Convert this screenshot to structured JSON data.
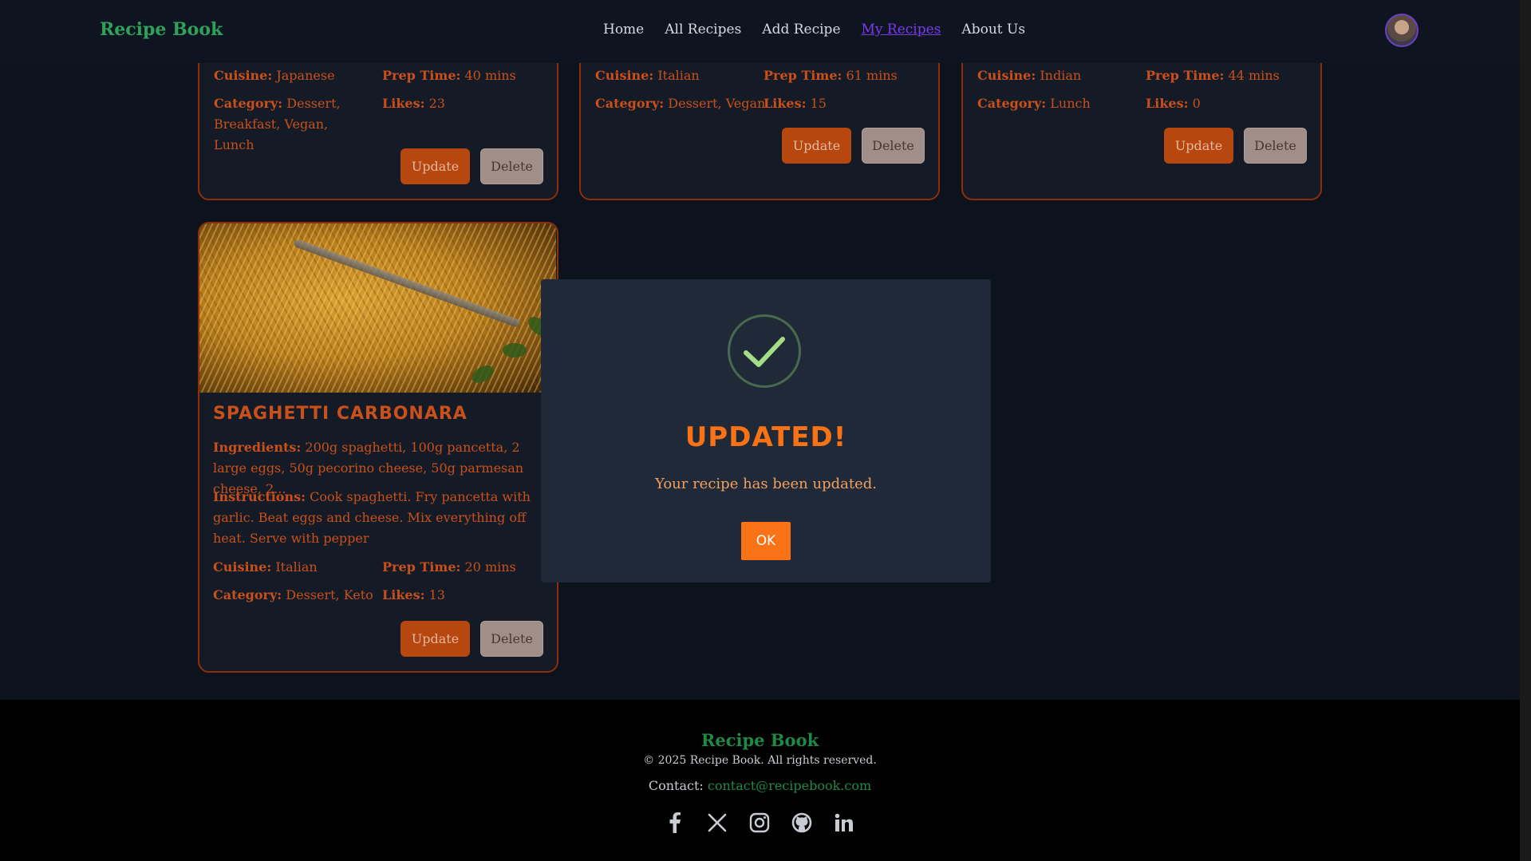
{
  "nav": {
    "brand": "Recipe Book",
    "links": [
      "Home",
      "All Recipes",
      "Add Recipe",
      "My Recipes",
      "About Us"
    ],
    "active": "My Recipes"
  },
  "cards_top": [
    {
      "cuisine_label": "Cuisine:",
      "cuisine": "Japanese",
      "prep_label": "Prep Time:",
      "prep": "40 mins",
      "category_label": "Category:",
      "category": "Dessert, Breakfast, Vegan, Lunch",
      "likes_label": "Likes:",
      "likes": "23",
      "update": "Update",
      "delete": "Delete"
    },
    {
      "cuisine_label": "Cuisine:",
      "cuisine": "Italian",
      "prep_label": "Prep Time:",
      "prep": "61 mins",
      "category_label": "Category:",
      "category": "Dessert, Vegan",
      "likes_label": "Likes:",
      "likes": "15",
      "update": "Update",
      "delete": "Delete"
    },
    {
      "cuisine_label": "Cuisine:",
      "cuisine": "Indian",
      "prep_label": "Prep Time:",
      "prep": "44 mins",
      "category_label": "Category:",
      "category": "Lunch",
      "likes_label": "Likes:",
      "likes": "0",
      "update": "Update",
      "delete": "Delete"
    }
  ],
  "card_main": {
    "title": "SPAGHETTI CARBONARA",
    "ingredients_label": "Ingredients:",
    "ingredients": "200g spaghetti, 100g pancetta, 2 large eggs, 50g pecorino cheese, 50g parmesan cheese, 2...",
    "instructions_label": "Instructions:",
    "instructions": "Cook spaghetti. Fry pancetta with garlic. Beat eggs and cheese. Mix everything off heat. Serve with pepper",
    "cuisine_label": "Cuisine:",
    "cuisine": "Italian",
    "prep_label": "Prep Time:",
    "prep": "20 mins",
    "category_label": "Category:",
    "category": "Dessert, Keto",
    "likes_label": "Likes:",
    "likes": "13",
    "update": "Update",
    "delete": "Delete"
  },
  "modal": {
    "title": "UPDATED!",
    "text": "Your recipe has been updated.",
    "ok": "OK"
  },
  "footer": {
    "brand": "Recipe Book",
    "copyright": "© 2025 Recipe Book. All rights reserved.",
    "contact_label": "Contact:",
    "contact_email": "contact@recipebook.com",
    "socials": [
      "facebook-icon",
      "x-icon",
      "instagram-icon",
      "github-icon",
      "linkedin-icon"
    ]
  },
  "colors": {
    "accent": "#f97316",
    "brand_green": "#2fa15a",
    "card_border": "#8a2e0c"
  }
}
